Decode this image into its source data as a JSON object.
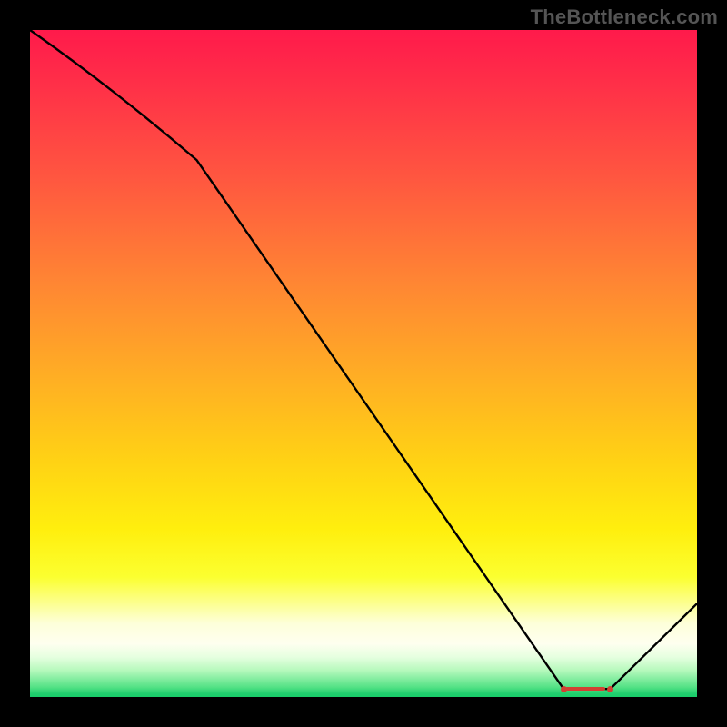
{
  "watermark": "TheBottleneck.com",
  "marker": {
    "label": "",
    "color": "#d24033"
  },
  "chart_data": {
    "type": "line",
    "title": "",
    "xlabel": "",
    "ylabel": "",
    "xlim": [
      0,
      100
    ],
    "ylim": [
      0,
      100
    ],
    "grid": false,
    "legend": false,
    "x": [
      0,
      25,
      80,
      87,
      100
    ],
    "values": [
      100,
      80.5,
      1.2,
      1.2,
      14
    ],
    "optimum_band_x": [
      80,
      87
    ],
    "optimum_y": 1.2,
    "note": "Values estimated from pixels; y=0 is the green baseline, y=100 is the top. The curve starts at the upper-left, slopes gently to ~x=25, descends roughly linearly to a minimum plateau around x≈80–87, then rises again."
  }
}
